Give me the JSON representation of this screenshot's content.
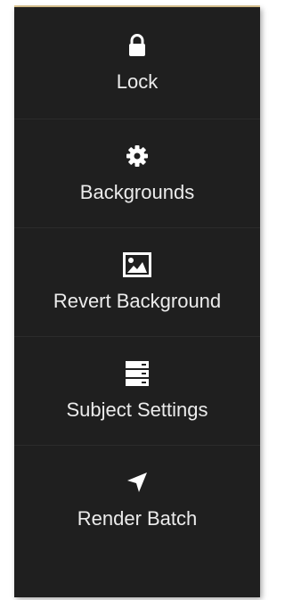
{
  "menu": {
    "items": [
      {
        "label": "Lock",
        "icon": "lock-icon"
      },
      {
        "label": "Backgrounds",
        "icon": "gear-icon"
      },
      {
        "label": "Revert Background",
        "icon": "image-icon"
      },
      {
        "label": "Subject Settings",
        "icon": "server-stack-icon"
      },
      {
        "label": "Render Batch",
        "icon": "location-arrow-icon"
      }
    ]
  },
  "colors": {
    "panel_background": "#1f1f1f",
    "text": "#ececec",
    "divider": "#2b2b2b"
  }
}
